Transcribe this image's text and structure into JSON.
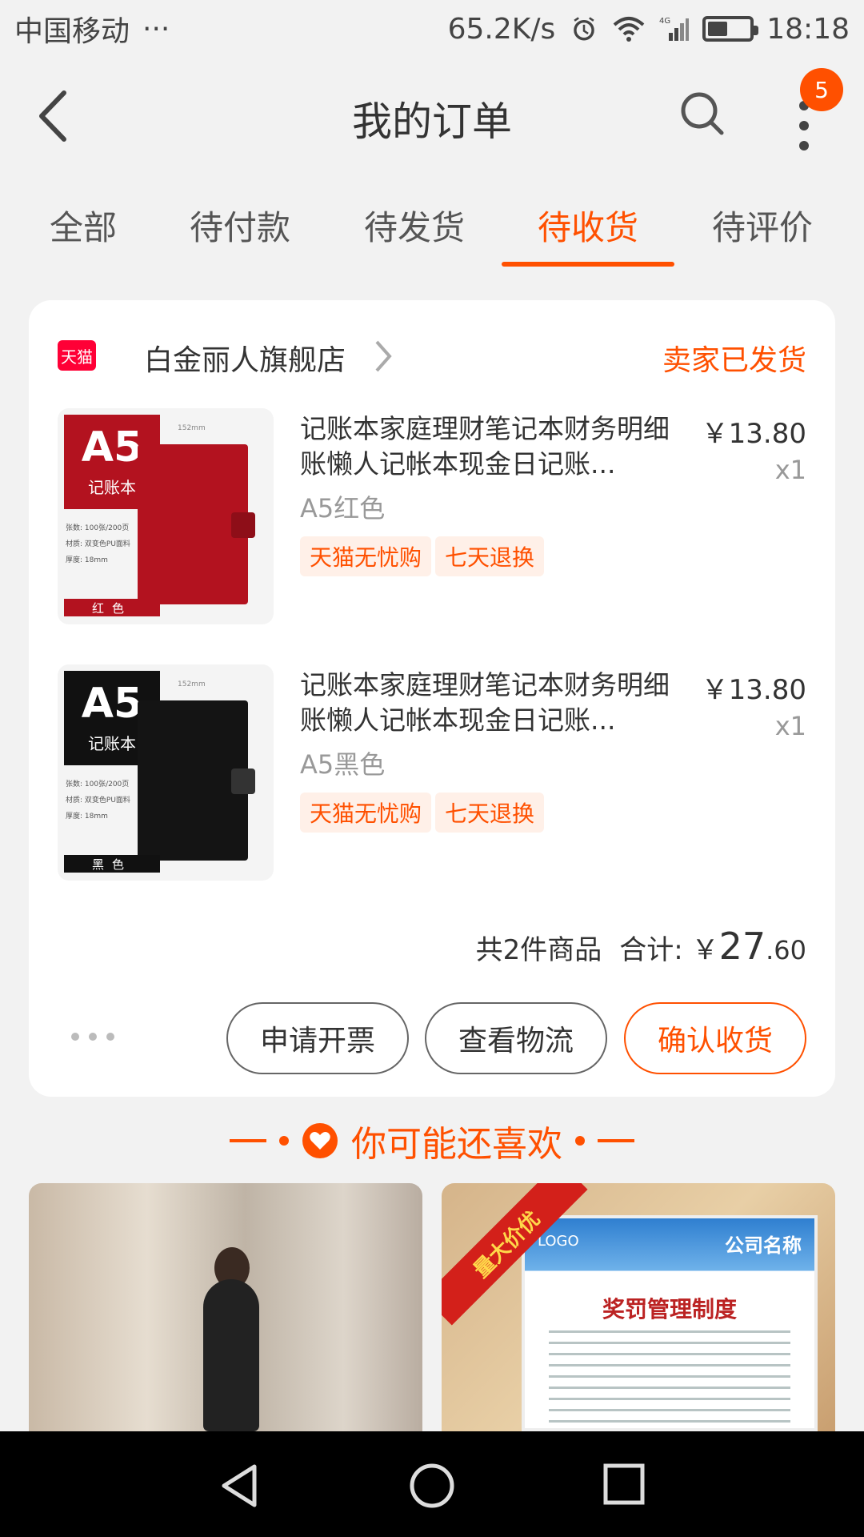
{
  "status_bar": {
    "carrier": "中国移动",
    "dots": "···",
    "speed": "65.2K/s",
    "network": "4G",
    "time": "18:18"
  },
  "header": {
    "title": "我的订单",
    "badge_count": "5"
  },
  "tabs": [
    {
      "label": "全部"
    },
    {
      "label": "待付款"
    },
    {
      "label": "待发货"
    },
    {
      "label": "待收货"
    },
    {
      "label": "待评价"
    }
  ],
  "active_tab_index": 3,
  "order": {
    "platform_badge": "天猫",
    "shop_name": "白金丽人旗舰店",
    "status": "卖家已发货",
    "items": [
      {
        "title": "记账本家庭理财笔记本财务明细账懒人记帐本现金日记账...",
        "price": "￥13.80",
        "qty": "x1",
        "variant": "A5红色",
        "tags": [
          "天猫无忧购",
          "七天退换"
        ],
        "thumb": {
          "a5": "A5",
          "sub": "记账本",
          "color_label": "红色",
          "book_color": "#b3121f",
          "badge_color": "#b3121f",
          "specs": [
            "张数: 100张/200页",
            "材质: 双变色PU面料",
            "厚度: 18mm"
          ],
          "dim": "152mm"
        }
      },
      {
        "title": "记账本家庭理财笔记本财务明细账懒人记帐本现金日记账...",
        "price": "￥13.80",
        "qty": "x1",
        "variant": "A5黑色",
        "tags": [
          "天猫无忧购",
          "七天退换"
        ],
        "thumb": {
          "a5": "A5",
          "sub": "记账本",
          "color_label": "黑色",
          "book_color": "#141414",
          "badge_color": "#111111",
          "specs": [
            "张数: 100张/200页",
            "材质: 双变色PU面料",
            "厚度: 18mm"
          ],
          "dim": "152mm"
        }
      }
    ],
    "summary": {
      "count_text": "共2件商品",
      "total_label": "合计: ￥",
      "total_integer": "27",
      "total_decimal": ".60"
    },
    "actions": {
      "invoice": "申请开票",
      "logistics": "查看物流",
      "confirm": "确认收货"
    }
  },
  "recommend": {
    "title": "你可能还喜欢",
    "right_card": {
      "ribbon": "量大价优",
      "logo": "LOGO",
      "company": "公司名称",
      "poster_title": "奖罚管理制度"
    }
  },
  "colors": {
    "accent": "#ff5000",
    "tmall_red": "#ff0036",
    "background": "#f2f2f2"
  }
}
